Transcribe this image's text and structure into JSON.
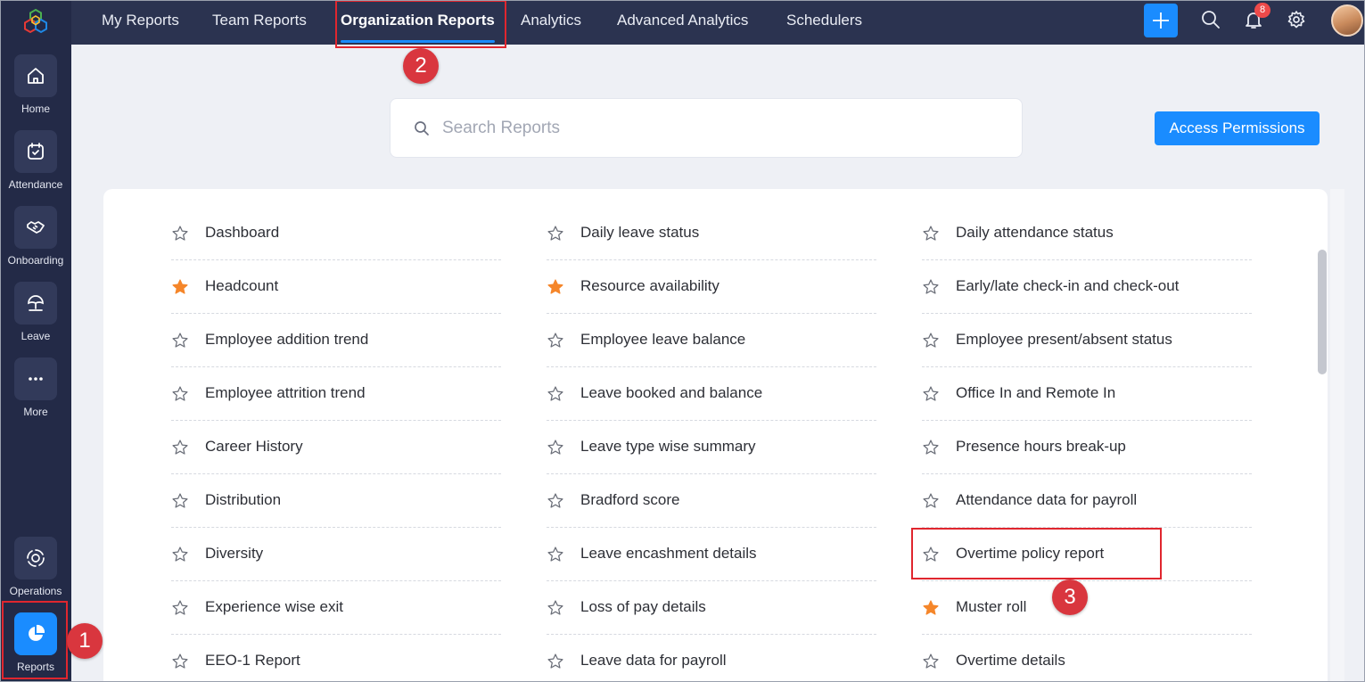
{
  "sidebar": {
    "items": [
      {
        "label": "Home",
        "icon": "home-icon"
      },
      {
        "label": "Attendance",
        "icon": "calendar-check-icon"
      },
      {
        "label": "Onboarding",
        "icon": "handshake-icon"
      },
      {
        "label": "Leave",
        "icon": "umbrella-icon"
      },
      {
        "label": "More",
        "icon": "more-dots-icon"
      },
      {
        "label": "Operations",
        "icon": "operations-icon"
      },
      {
        "label": "Reports",
        "icon": "pie-chart-icon",
        "active": true
      }
    ]
  },
  "topbar": {
    "tabs": [
      {
        "label": "My Reports"
      },
      {
        "label": "Team Reports"
      },
      {
        "label": "Organization Reports",
        "active": true
      },
      {
        "label": "Analytics"
      },
      {
        "label": "Advanced Analytics"
      },
      {
        "label": "Schedulers"
      }
    ],
    "notification_count": "8"
  },
  "search": {
    "placeholder": "Search Reports",
    "value": ""
  },
  "access_permissions_label": "Access Permissions",
  "reports": {
    "col1": [
      {
        "label": "Dashboard",
        "starred": false
      },
      {
        "label": "Headcount",
        "starred": true
      },
      {
        "label": "Employee addition trend",
        "starred": false
      },
      {
        "label": "Employee attrition trend",
        "starred": false
      },
      {
        "label": "Career History",
        "starred": false
      },
      {
        "label": "Distribution",
        "starred": false
      },
      {
        "label": "Diversity",
        "starred": false
      },
      {
        "label": "Experience wise exit",
        "starred": false
      },
      {
        "label": "EEO-1 Report",
        "starred": false
      }
    ],
    "col2": [
      {
        "label": "Daily leave status",
        "starred": false
      },
      {
        "label": "Resource availability",
        "starred": true
      },
      {
        "label": "Employee leave balance",
        "starred": false
      },
      {
        "label": "Leave booked and balance",
        "starred": false
      },
      {
        "label": "Leave type wise summary",
        "starred": false
      },
      {
        "label": "Bradford score",
        "starred": false
      },
      {
        "label": "Leave encashment details",
        "starred": false
      },
      {
        "label": "Loss of pay details",
        "starred": false
      },
      {
        "label": "Leave data for payroll",
        "starred": false
      }
    ],
    "col3": [
      {
        "label": "Daily attendance status",
        "starred": false
      },
      {
        "label": "Early/late check-in and check-out",
        "starred": false
      },
      {
        "label": "Employee present/absent status",
        "starred": false
      },
      {
        "label": "Office In and Remote In",
        "starred": false
      },
      {
        "label": "Presence hours break-up",
        "starred": false
      },
      {
        "label": "Attendance data for payroll",
        "starred": false
      },
      {
        "label": "Overtime policy report",
        "starred": false
      },
      {
        "label": "Muster roll",
        "starred": true
      },
      {
        "label": "Overtime details",
        "starred": false
      }
    ]
  },
  "annotations": [
    "1",
    "2",
    "3"
  ],
  "colors": {
    "accent": "#1a8cff",
    "star_filled": "#f5862a",
    "annotation": "#d9363e"
  }
}
